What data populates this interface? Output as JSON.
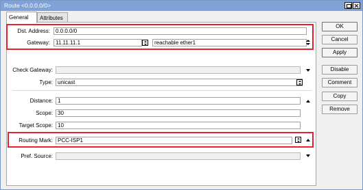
{
  "window": {
    "title": "Route <0.0.0.0/0>"
  },
  "tabs": [
    {
      "label": "General"
    },
    {
      "label": "Attributes"
    }
  ],
  "form": {
    "dst_address": {
      "label": "Dst. Address:",
      "value": "0.0.0.0/0"
    },
    "gateway": {
      "label": "Gateway:",
      "value": "11.11.11.1",
      "status": "reachable ether1"
    },
    "check_gateway": {
      "label": "Check Gateway:",
      "value": ""
    },
    "type": {
      "label": "Type:",
      "value": "unicast"
    },
    "distance": {
      "label": "Distance:",
      "value": "1"
    },
    "scope": {
      "label": "Scope:",
      "value": "30"
    },
    "target_scope": {
      "label": "Target Scope:",
      "value": "10"
    },
    "routing_mark": {
      "label": "Routing Mark:",
      "value": "PCC-ISP1"
    },
    "pref_source": {
      "label": "Pref. Source:",
      "value": ""
    }
  },
  "buttons": {
    "ok": "OK",
    "cancel": "Cancel",
    "apply": "Apply",
    "disable": "Disable",
    "comment": "Comment",
    "copy": "Copy",
    "remove": "Remove"
  },
  "icons": {
    "window_restore": "restore-icon",
    "window_close": "close-icon",
    "dropdown": "updown-arrow-icon",
    "expand": "triangle-down-icon",
    "collapse": "triangle-up-icon"
  },
  "colors": {
    "titlebar": "#7fa3d8",
    "highlight": "#e8202e"
  }
}
